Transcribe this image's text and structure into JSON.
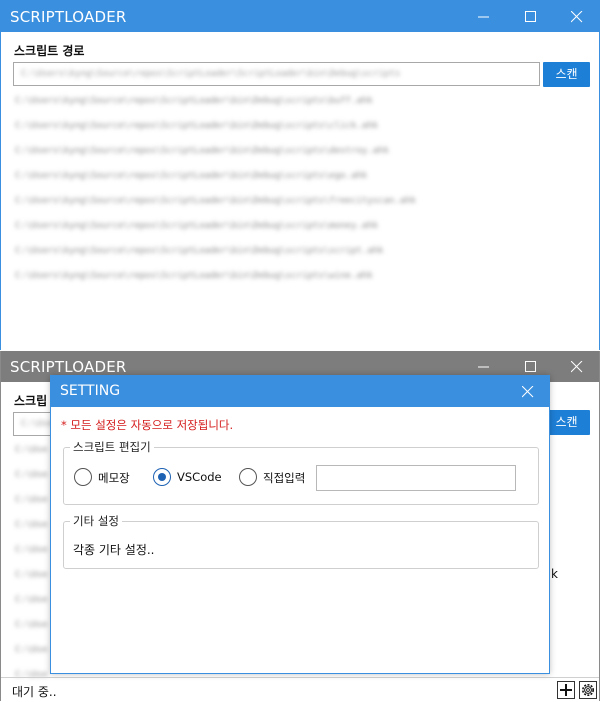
{
  "window_back": {
    "title": "SCRIPTLOADER",
    "path_label": "스크립트 경로",
    "path_value": "C:\\Users\\kyng\\Source\\repos\\ScriptLoader\\ScriptLoader\\bin\\Debug\\scripts",
    "scan_label": "스캔",
    "files": [
      "C:\\Users\\kyng\\Source\\repos\\ScriptLoader\\bin\\Debug\\scripts\\buff.ahk",
      "C:\\Users\\kyng\\Source\\repos\\ScriptLoader\\bin\\Debug\\scripts\\click.ahk",
      "C:\\Users\\kyng\\Source\\repos\\ScriptLoader\\bin\\Debug\\scripts\\destroy.ahk",
      "C:\\Users\\kyng\\Source\\repos\\ScriptLoader\\bin\\Debug\\scripts\\ego.ahk",
      "C:\\Users\\kyng\\Source\\repos\\ScriptLoader\\bin\\Debug\\scripts\\freecityscan.ahk",
      "C:\\Users\\kyng\\Source\\repos\\ScriptLoader\\bin\\Debug\\scripts\\money.ahk",
      "C:\\Users\\kyng\\Source\\repos\\ScriptLoader\\bin\\Debug\\scripts\\script.ahk",
      "C:\\Users\\kyng\\Source\\repos\\ScriptLoader\\bin\\Debug\\scripts\\wine.ahk"
    ]
  },
  "window_front": {
    "title": "SCRIPTLOADER",
    "path_label": "스크립",
    "scan_label": "스캔",
    "partial_path": "C:\\Use",
    "partial_files": [
      "C:\\Use",
      "C:\\Use",
      "C:\\Use",
      "C:\\Use",
      "C:\\Use",
      "C:\\Use",
      "C:\\Use",
      "C:\\Use",
      "C:\\Use",
      "C:\\Use"
    ],
    "overflow_char": "k",
    "status": "대기 중..",
    "add_icon": "plus-icon",
    "settings_icon": "gear-icon"
  },
  "dialog": {
    "title": "SETTING",
    "notice": "* 모든 설정은 자동으로 저장됩니다.",
    "editor_group": "스크립트 편집기",
    "options": [
      {
        "label": "메모장",
        "checked": false
      },
      {
        "label": "VSCode",
        "checked": true
      },
      {
        "label": "직접입력",
        "checked": false
      }
    ],
    "direct_input_value": "",
    "etc_group": "기타 설정",
    "etc_text": "각종 기타 설정.."
  },
  "colors": {
    "active_titlebar": "#3a8fdf",
    "inactive_titlebar": "#7d7d7d",
    "scan_button": "#1e7fd6",
    "notice": "#d41c1c",
    "radio_checked": "#1e62b4"
  }
}
